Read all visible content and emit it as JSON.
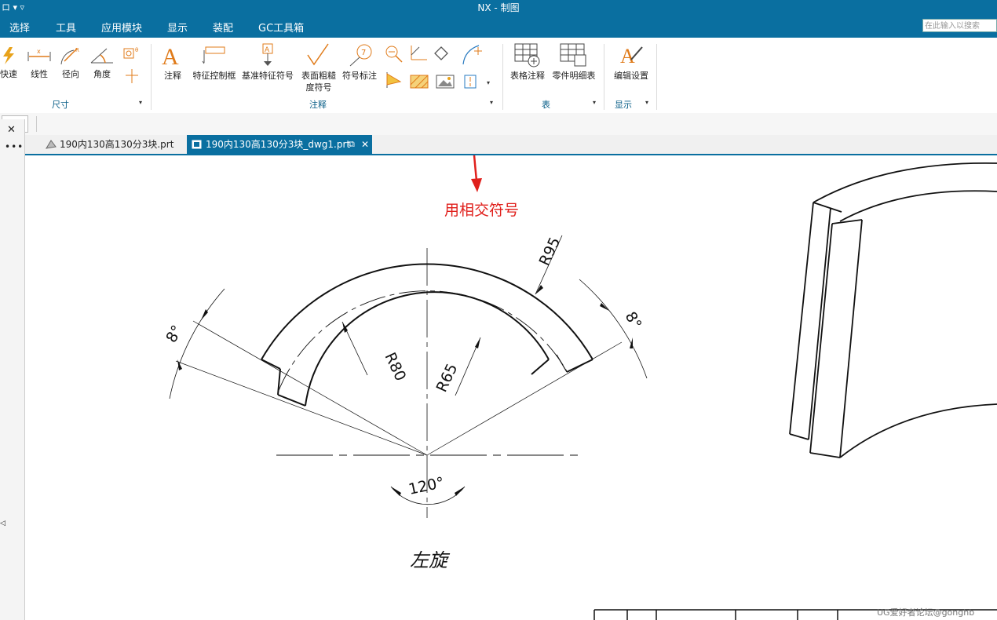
{
  "window": {
    "title": "NX - 制图",
    "quick_access": "ロ ▾ ▿"
  },
  "menu": {
    "items": [
      "选择",
      "工具",
      "应用模块",
      "显示",
      "装配",
      "GC工具箱"
    ],
    "search_placeholder": "在此输入以搜索"
  },
  "ribbon": {
    "dimension": {
      "buttons": [
        "快速",
        "线性",
        "径向",
        "角度"
      ],
      "group_label": "尺寸"
    },
    "annotation": {
      "note": "注释",
      "fcf": "特征控制框",
      "datum": "基准特征符号",
      "surface_line1": "表面粗糙",
      "surface_line2": "度符号",
      "balloon": "符号标注",
      "group_label": "注释"
    },
    "table": {
      "buttons": [
        "表格注释",
        "零件明细表"
      ],
      "group_label": "表"
    },
    "display": {
      "buttons": [
        "编辑设置"
      ],
      "group_label": "显示"
    }
  },
  "tabs": [
    {
      "label": "190内130高130分3块.prt",
      "active": false
    },
    {
      "label": "190内130高130分3块_dwg1.prt",
      "active": true
    }
  ],
  "annotation_text": "用相交符号",
  "drawing": {
    "r95": "R95",
    "r80": "R80",
    "r65": "R65",
    "angle_left": "8°",
    "angle_right": "8°",
    "angle_bottom": "120°",
    "note": "左旋"
  },
  "watermark": "UG爱好者论坛@gonghb",
  "colors": {
    "title_bar": "#0a6fa0",
    "ribbon_icon": "#e07b1a",
    "annotation_red": "#e0201c"
  }
}
